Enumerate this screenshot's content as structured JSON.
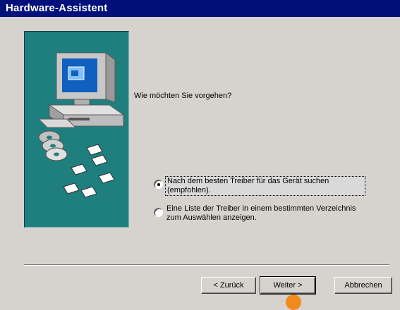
{
  "window": {
    "title": "Hardware-Assistent"
  },
  "wizard": {
    "question": "Wie möchten Sie vorgehen?",
    "options": [
      {
        "label": "Nach dem besten Treiber für das Gerät suchen (empfohlen).",
        "selected": true
      },
      {
        "label": "Eine Liste der Treiber in einem bestimmten Verzeichnis zum Auswählen anzeigen.",
        "selected": false
      }
    ]
  },
  "buttons": {
    "back_label": "< Zurück",
    "next_label": "Weiter >",
    "cancel_label": "Abbrechen"
  },
  "colors": {
    "title_bar": "#00107a",
    "dialog_bg": "#d6d3ce",
    "art_bg": "#1f7f7f",
    "cursor_marker": "#f08a1c"
  }
}
